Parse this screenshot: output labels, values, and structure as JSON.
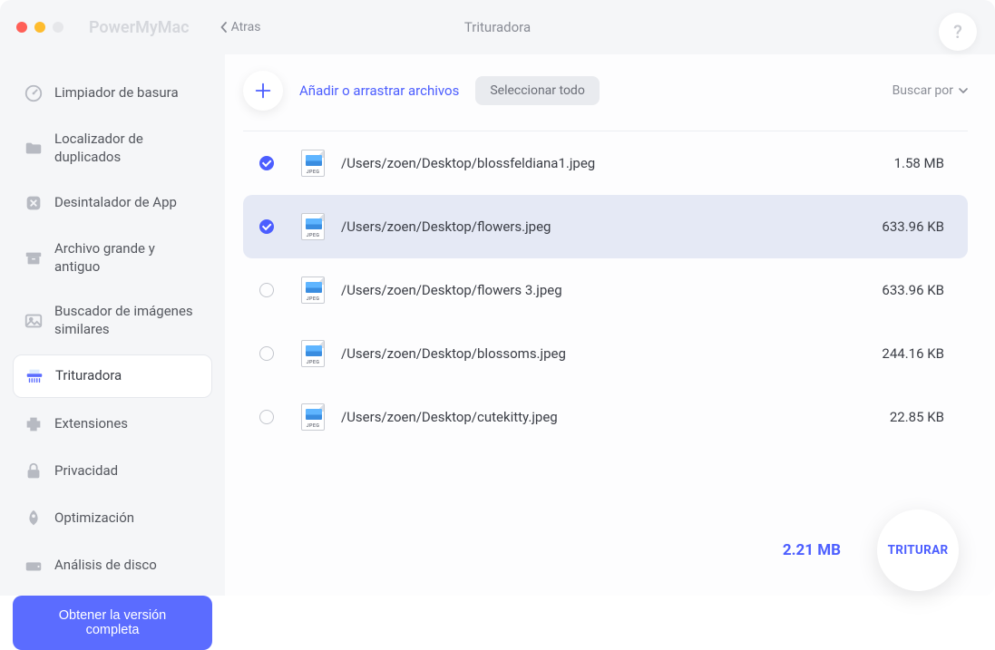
{
  "titlebar": {
    "app_name": "PowerMyMac",
    "back_label": "Atras",
    "page_title": "Trituradora",
    "help_glyph": "?"
  },
  "sidebar": {
    "items": [
      {
        "label": "Limpiador de basura"
      },
      {
        "label": "Localizador de duplicados"
      },
      {
        "label": "Desintalador de App"
      },
      {
        "label": "Archivo grande y antiguo"
      },
      {
        "label": "Buscador de imágenes similares"
      },
      {
        "label": "Trituradora"
      },
      {
        "label": "Extensiones"
      },
      {
        "label": "Privacidad"
      },
      {
        "label": "Optimización"
      },
      {
        "label": "Análisis de disco"
      }
    ],
    "get_full_label": "Obtener la versión completa"
  },
  "toolbar": {
    "add_label": "Añadir o arrastrar archivos",
    "select_all_label": "Seleccionar todo",
    "search_by_label": "Buscar por"
  },
  "files": [
    {
      "path": "/Users/zoen/Desktop/blossfeldiana1.jpeg",
      "size": "1.58 MB",
      "checked": true,
      "highlighted": false,
      "ext": "JPEG"
    },
    {
      "path": "/Users/zoen/Desktop/flowers.jpeg",
      "size": "633.96 KB",
      "checked": true,
      "highlighted": true,
      "ext": "JPEG"
    },
    {
      "path": "/Users/zoen/Desktop/flowers 3.jpeg",
      "size": "633.96 KB",
      "checked": false,
      "highlighted": false,
      "ext": "JPEG"
    },
    {
      "path": "/Users/zoen/Desktop/blossoms.jpeg",
      "size": "244.16 KB",
      "checked": false,
      "highlighted": false,
      "ext": "JPEG"
    },
    {
      "path": "/Users/zoen/Desktop/cutekitty.jpeg",
      "size": "22.85 KB",
      "checked": false,
      "highlighted": false,
      "ext": "JPEG"
    }
  ],
  "footer": {
    "total_size": "2.21 MB",
    "shred_label": "TRITURAR"
  }
}
